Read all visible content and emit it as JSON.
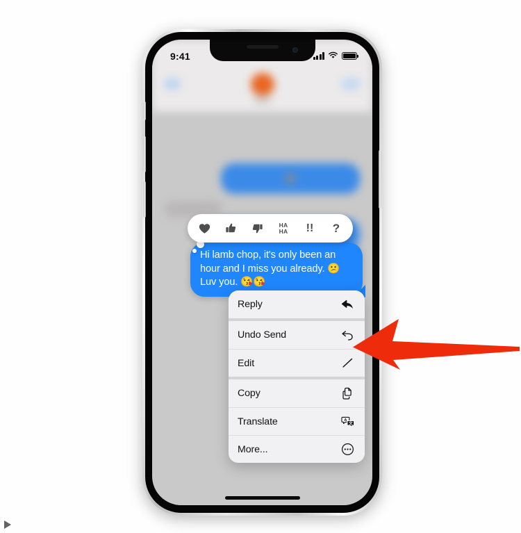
{
  "status_bar": {
    "time": "9:41",
    "signal_icon": "cellular-bars-icon",
    "wifi_icon": "wifi-icon",
    "battery_icon": "battery-full-icon"
  },
  "tapback": {
    "options": [
      {
        "name": "heart",
        "glyph": "♥"
      },
      {
        "name": "thumbs-up",
        "glyph": "👍"
      },
      {
        "name": "thumbs-down",
        "glyph": "👎"
      },
      {
        "name": "haha",
        "glyph": "HA\nHA"
      },
      {
        "name": "exclamation",
        "glyph": "‼"
      },
      {
        "name": "question",
        "glyph": "?"
      }
    ],
    "haha_line1": "HA",
    "haha_line2": "HA",
    "bang": "!!",
    "question": "?"
  },
  "message": {
    "text": "Hi lamb chop, it's only been an hour and I miss you already. 😕 Luv you. 😘😘",
    "direction": "outgoing",
    "bubble_color": "#1f86fd",
    "text_color": "#ffffff"
  },
  "context_menu": {
    "groups": [
      {
        "items": [
          {
            "label": "Reply",
            "icon": "reply-arrow-icon"
          }
        ]
      },
      {
        "items": [
          {
            "label": "Undo Send",
            "icon": "undo-arrow-icon"
          },
          {
            "label": "Edit",
            "icon": "pencil-icon"
          }
        ]
      },
      {
        "items": [
          {
            "label": "Copy",
            "icon": "copy-pages-icon"
          },
          {
            "label": "Translate",
            "icon": "translate-icon"
          },
          {
            "label": "More...",
            "icon": "ellipsis-circle-icon"
          }
        ]
      }
    ],
    "items_flat": {
      "reply": "Reply",
      "undo_send": "Undo Send",
      "edit": "Edit",
      "copy": "Copy",
      "translate": "Translate",
      "more": "More..."
    }
  },
  "annotation": {
    "arrow": {
      "name": "red-pointer-arrow",
      "color": "#ee2b0a",
      "direction": "left",
      "points_at": "Undo Send"
    }
  },
  "device": {
    "home_indicator": "home-indicator",
    "buttons": [
      "mute-switch",
      "volume-up",
      "volume-down",
      "power"
    ]
  },
  "page": {
    "play_glyph": "play-triangle-icon"
  }
}
